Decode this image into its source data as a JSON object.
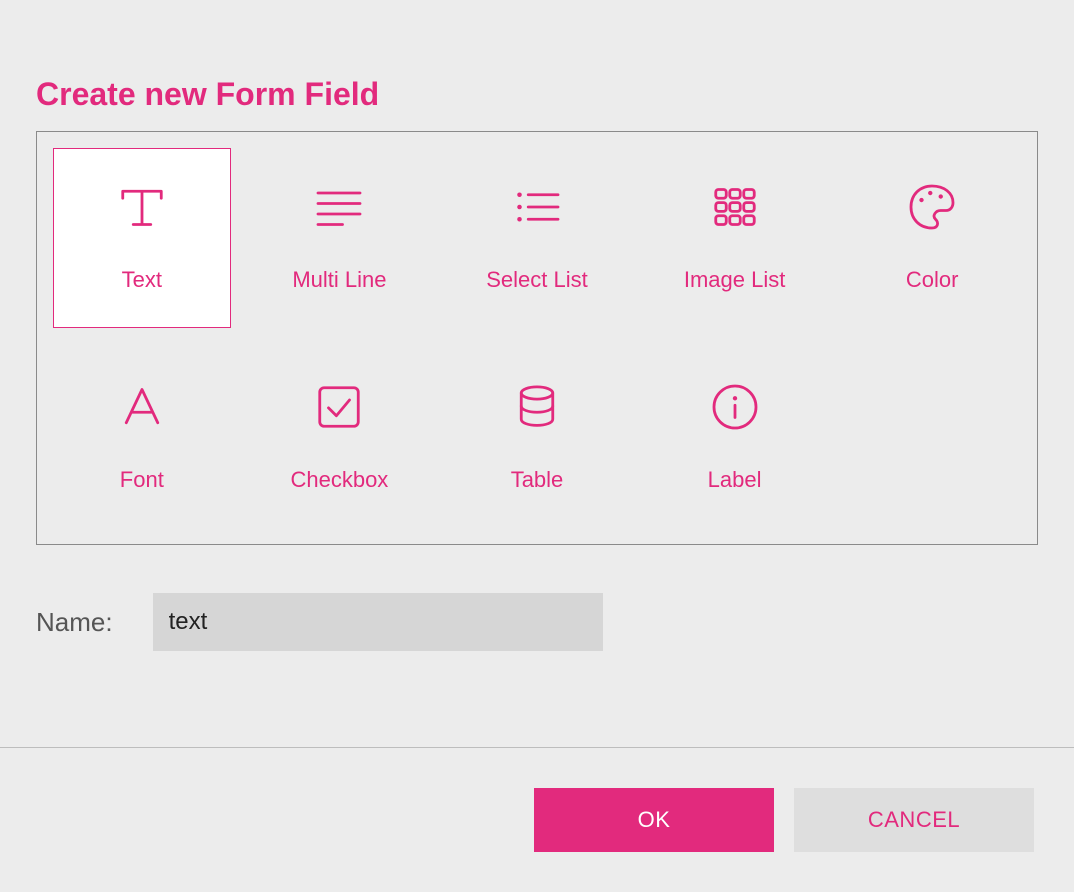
{
  "colors": {
    "accent": "#e22a7d",
    "background": "#ececec"
  },
  "dialog": {
    "title": "Create new Form Field"
  },
  "field_types": [
    {
      "id": "text",
      "label": "Text",
      "icon": "text-icon",
      "selected": true
    },
    {
      "id": "multiline",
      "label": "Multi Line",
      "icon": "multiline-icon",
      "selected": false
    },
    {
      "id": "selectlist",
      "label": "Select List",
      "icon": "selectlist-icon",
      "selected": false
    },
    {
      "id": "imagelist",
      "label": "Image List",
      "icon": "imagelist-icon",
      "selected": false
    },
    {
      "id": "color",
      "label": "Color",
      "icon": "palette-icon",
      "selected": false
    },
    {
      "id": "font",
      "label": "Font",
      "icon": "font-icon",
      "selected": false
    },
    {
      "id": "checkbox",
      "label": "Checkbox",
      "icon": "checkbox-icon",
      "selected": false
    },
    {
      "id": "table",
      "label": "Table",
      "icon": "table-icon",
      "selected": false
    },
    {
      "id": "label",
      "label": "Label",
      "icon": "info-icon",
      "selected": false
    }
  ],
  "name_field": {
    "label": "Name:",
    "value": "text"
  },
  "buttons": {
    "ok": "OK",
    "cancel": "CANCEL"
  }
}
